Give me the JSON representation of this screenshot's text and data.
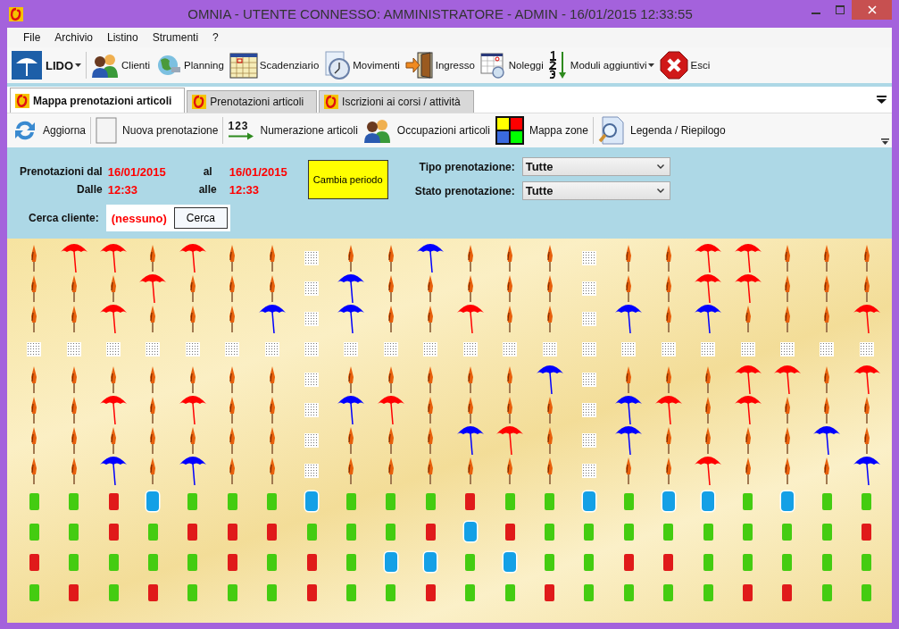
{
  "window": {
    "title": "OMNIA - UTENTE CONNESSO: AMMINISTRATORE - ADMIN - 16/01/2015 12:33:55"
  },
  "menu": [
    "File",
    "Archivio",
    "Listino",
    "Strumenti",
    "?"
  ],
  "toolbar": [
    {
      "label": "LIDO",
      "dropdown": true
    },
    {
      "label": "Clienti",
      "dropdown": false
    },
    {
      "label": "Planning",
      "dropdown": false
    },
    {
      "label": "Scadenziario",
      "dropdown": false
    },
    {
      "label": "Movimenti",
      "dropdown": false
    },
    {
      "label": "Ingresso",
      "dropdown": false
    },
    {
      "label": "Noleggi",
      "dropdown": false
    },
    {
      "label": "Moduli aggiuntivi",
      "dropdown": true
    },
    {
      "label": "Esci",
      "dropdown": false
    }
  ],
  "tabs": [
    {
      "label": "Mappa prenotazioni articoli",
      "selected": true
    },
    {
      "label": "Prenotazioni articoli",
      "selected": false
    },
    {
      "label": "Iscrizioni ai corsi / attività",
      "selected": false
    }
  ],
  "subtoolbar": [
    {
      "label": "Aggiorna"
    },
    {
      "label": "Nuova prenotazione"
    },
    {
      "label": "Numerazione articoli",
      "icon_text": "123"
    },
    {
      "label": "Occupazioni articoli"
    },
    {
      "label": "Mappa zone"
    },
    {
      "label": "Legenda / Riepilogo"
    }
  ],
  "filters": {
    "period_label": "Prenotazioni dal",
    "date_from": "16/01/2015",
    "to_label": "al",
    "date_to": "16/01/2015",
    "time_label": "Dalle",
    "time_from": "12:33",
    "time_to_label": "alle",
    "time_to": "12:33",
    "change_button": "Cambia periodo",
    "customer_label": "Cerca cliente:",
    "customer_value": "(nessuno)",
    "search_button": "Cerca",
    "type_label": "Tipo prenotazione:",
    "type_value": "Tutte",
    "status_label": "Stato prenotazione:",
    "status_value": "Tutte"
  },
  "beach": {
    "rows": [
      {
        "cells": [
          {
            "kind": "closed"
          },
          {
            "kind": "red"
          },
          {
            "kind": "red"
          },
          {
            "kind": "closed"
          },
          {
            "kind": "red"
          },
          {
            "kind": "closed"
          },
          {
            "kind": "closed"
          },
          {
            "kind": "walkway"
          },
          {
            "kind": "closed"
          },
          {
            "kind": "closed"
          },
          {
            "kind": "blue"
          },
          {
            "kind": "closed"
          },
          {
            "kind": "closed"
          },
          {
            "kind": "closed"
          },
          {
            "kind": "walkway"
          },
          {
            "kind": "closed"
          },
          {
            "kind": "closed"
          },
          {
            "kind": "red"
          },
          {
            "kind": "red"
          },
          {
            "kind": "closed"
          },
          {
            "kind": "closed"
          },
          {
            "kind": "closed"
          }
        ]
      },
      {
        "cells": [
          {
            "kind": "closed"
          },
          {
            "kind": "closed"
          },
          {
            "kind": "closed"
          },
          {
            "kind": "red"
          },
          {
            "kind": "closed"
          },
          {
            "kind": "closed"
          },
          {
            "kind": "closed"
          },
          {
            "kind": "walkway"
          },
          {
            "kind": "blue"
          },
          {
            "kind": "closed"
          },
          {
            "kind": "closed"
          },
          {
            "kind": "closed"
          },
          {
            "kind": "closed"
          },
          {
            "kind": "closed"
          },
          {
            "kind": "walkway"
          },
          {
            "kind": "closed"
          },
          {
            "kind": "closed"
          },
          {
            "kind": "red"
          },
          {
            "kind": "red"
          },
          {
            "kind": "closed"
          },
          {
            "kind": "closed"
          },
          {
            "kind": "closed"
          }
        ]
      },
      {
        "cells": [
          {
            "kind": "closed"
          },
          {
            "kind": "closed"
          },
          {
            "kind": "red"
          },
          {
            "kind": "closed"
          },
          {
            "kind": "closed"
          },
          {
            "kind": "closed"
          },
          {
            "kind": "blue"
          },
          {
            "kind": "walkway"
          },
          {
            "kind": "blue"
          },
          {
            "kind": "closed"
          },
          {
            "kind": "closed"
          },
          {
            "kind": "red"
          },
          {
            "kind": "closed"
          },
          {
            "kind": "closed"
          },
          {
            "kind": "walkway"
          },
          {
            "kind": "blue"
          },
          {
            "kind": "closed"
          },
          {
            "kind": "blue"
          },
          {
            "kind": "closed"
          },
          {
            "kind": "closed"
          },
          {
            "kind": "closed"
          },
          {
            "kind": "red"
          }
        ]
      },
      {
        "cells": [
          {
            "kind": "walkway"
          },
          {
            "kind": "walkway"
          },
          {
            "kind": "walkway"
          },
          {
            "kind": "walkway"
          },
          {
            "kind": "walkway"
          },
          {
            "kind": "walkway"
          },
          {
            "kind": "walkway"
          },
          {
            "kind": "walkway"
          },
          {
            "kind": "walkway"
          },
          {
            "kind": "walkway"
          },
          {
            "kind": "walkway"
          },
          {
            "kind": "walkway"
          },
          {
            "kind": "walkway"
          },
          {
            "kind": "walkway"
          },
          {
            "kind": "walkway"
          },
          {
            "kind": "walkway"
          },
          {
            "kind": "walkway"
          },
          {
            "kind": "walkway"
          },
          {
            "kind": "walkway"
          },
          {
            "kind": "walkway"
          },
          {
            "kind": "walkway"
          },
          {
            "kind": "walkway"
          }
        ]
      },
      {
        "cells": [
          {
            "kind": "closed"
          },
          {
            "kind": "closed"
          },
          {
            "kind": "closed"
          },
          {
            "kind": "closed"
          },
          {
            "kind": "closed"
          },
          {
            "kind": "closed"
          },
          {
            "kind": "closed"
          },
          {
            "kind": "walkway"
          },
          {
            "kind": "closed"
          },
          {
            "kind": "closed"
          },
          {
            "kind": "closed"
          },
          {
            "kind": "closed"
          },
          {
            "kind": "closed"
          },
          {
            "kind": "blue"
          },
          {
            "kind": "walkway"
          },
          {
            "kind": "closed"
          },
          {
            "kind": "closed"
          },
          {
            "kind": "closed"
          },
          {
            "kind": "red"
          },
          {
            "kind": "red"
          },
          {
            "kind": "closed"
          },
          {
            "kind": "red"
          }
        ]
      },
      {
        "cells": [
          {
            "kind": "closed"
          },
          {
            "kind": "closed"
          },
          {
            "kind": "red"
          },
          {
            "kind": "closed"
          },
          {
            "kind": "red"
          },
          {
            "kind": "closed"
          },
          {
            "kind": "closed"
          },
          {
            "kind": "walkway"
          },
          {
            "kind": "blue"
          },
          {
            "kind": "red"
          },
          {
            "kind": "closed"
          },
          {
            "kind": "closed"
          },
          {
            "kind": "closed"
          },
          {
            "kind": "closed"
          },
          {
            "kind": "walkway"
          },
          {
            "kind": "blue"
          },
          {
            "kind": "red"
          },
          {
            "kind": "closed"
          },
          {
            "kind": "red"
          },
          {
            "kind": "closed"
          },
          {
            "kind": "closed"
          },
          {
            "kind": "closed"
          }
        ]
      },
      {
        "cells": [
          {
            "kind": "closed"
          },
          {
            "kind": "closed"
          },
          {
            "kind": "closed"
          },
          {
            "kind": "closed"
          },
          {
            "kind": "closed"
          },
          {
            "kind": "closed"
          },
          {
            "kind": "closed"
          },
          {
            "kind": "walkway"
          },
          {
            "kind": "closed"
          },
          {
            "kind": "closed"
          },
          {
            "kind": "closed"
          },
          {
            "kind": "blue"
          },
          {
            "kind": "red"
          },
          {
            "kind": "closed"
          },
          {
            "kind": "walkway"
          },
          {
            "kind": "blue"
          },
          {
            "kind": "closed"
          },
          {
            "kind": "closed"
          },
          {
            "kind": "closed"
          },
          {
            "kind": "closed"
          },
          {
            "kind": "blue"
          },
          {
            "kind": "closed"
          }
        ]
      },
      {
        "cells": [
          {
            "kind": "closed"
          },
          {
            "kind": "closed"
          },
          {
            "kind": "blue"
          },
          {
            "kind": "closed"
          },
          {
            "kind": "blue"
          },
          {
            "kind": "closed"
          },
          {
            "kind": "closed"
          },
          {
            "kind": "walkway"
          },
          {
            "kind": "closed"
          },
          {
            "kind": "closed"
          },
          {
            "kind": "closed"
          },
          {
            "kind": "closed"
          },
          {
            "kind": "closed"
          },
          {
            "kind": "closed"
          },
          {
            "kind": "walkway"
          },
          {
            "kind": "closed"
          },
          {
            "kind": "closed"
          },
          {
            "kind": "red"
          },
          {
            "kind": "closed"
          },
          {
            "kind": "closed"
          },
          {
            "kind": "closed"
          },
          {
            "kind": "blue"
          }
        ]
      },
      {
        "cells": [
          {
            "kind": "cabin-green"
          },
          {
            "kind": "cabin-green"
          },
          {
            "kind": "cabin-red"
          },
          {
            "kind": "cabin-blue"
          },
          {
            "kind": "cabin-green"
          },
          {
            "kind": "cabin-green"
          },
          {
            "kind": "cabin-green"
          },
          {
            "kind": "cabin-blue"
          },
          {
            "kind": "cabin-green"
          },
          {
            "kind": "cabin-green"
          },
          {
            "kind": "cabin-green"
          },
          {
            "kind": "cabin-red"
          },
          {
            "kind": "cabin-green"
          },
          {
            "kind": "cabin-green"
          },
          {
            "kind": "cabin-blue"
          },
          {
            "kind": "cabin-green"
          },
          {
            "kind": "cabin-blue"
          },
          {
            "kind": "cabin-blue"
          },
          {
            "kind": "cabin-green"
          },
          {
            "kind": "cabin-blue"
          },
          {
            "kind": "cabin-green"
          },
          {
            "kind": "cabin-green"
          }
        ]
      },
      {
        "cells": [
          {
            "kind": "cabin-green"
          },
          {
            "kind": "cabin-green"
          },
          {
            "kind": "cabin-red"
          },
          {
            "kind": "cabin-green"
          },
          {
            "kind": "cabin-red"
          },
          {
            "kind": "cabin-red"
          },
          {
            "kind": "cabin-red"
          },
          {
            "kind": "cabin-green"
          },
          {
            "kind": "cabin-green"
          },
          {
            "kind": "cabin-green"
          },
          {
            "kind": "cabin-red"
          },
          {
            "kind": "cabin-blue"
          },
          {
            "kind": "cabin-red"
          },
          {
            "kind": "cabin-green"
          },
          {
            "kind": "cabin-green"
          },
          {
            "kind": "cabin-green"
          },
          {
            "kind": "cabin-green"
          },
          {
            "kind": "cabin-green"
          },
          {
            "kind": "cabin-green"
          },
          {
            "kind": "cabin-green"
          },
          {
            "kind": "cabin-green"
          },
          {
            "kind": "cabin-red"
          }
        ]
      },
      {
        "cells": [
          {
            "kind": "cabin-red"
          },
          {
            "kind": "cabin-green"
          },
          {
            "kind": "cabin-green"
          },
          {
            "kind": "cabin-green"
          },
          {
            "kind": "cabin-green"
          },
          {
            "kind": "cabin-red"
          },
          {
            "kind": "cabin-green"
          },
          {
            "kind": "cabin-red"
          },
          {
            "kind": "cabin-green"
          },
          {
            "kind": "cabin-blue"
          },
          {
            "kind": "cabin-blue"
          },
          {
            "kind": "cabin-green"
          },
          {
            "kind": "cabin-blue"
          },
          {
            "kind": "cabin-green"
          },
          {
            "kind": "cabin-green"
          },
          {
            "kind": "cabin-red"
          },
          {
            "kind": "cabin-red"
          },
          {
            "kind": "cabin-green"
          },
          {
            "kind": "cabin-green"
          },
          {
            "kind": "cabin-green"
          },
          {
            "kind": "cabin-green"
          },
          {
            "kind": "cabin-green"
          }
        ]
      },
      {
        "cells": [
          {
            "kind": "cabin-green"
          },
          {
            "kind": "cabin-red"
          },
          {
            "kind": "cabin-green"
          },
          {
            "kind": "cabin-red"
          },
          {
            "kind": "cabin-green"
          },
          {
            "kind": "cabin-green"
          },
          {
            "kind": "cabin-green"
          },
          {
            "kind": "cabin-red"
          },
          {
            "kind": "cabin-green"
          },
          {
            "kind": "cabin-green"
          },
          {
            "kind": "cabin-red"
          },
          {
            "kind": "cabin-green"
          },
          {
            "kind": "cabin-green"
          },
          {
            "kind": "cabin-red"
          },
          {
            "kind": "cabin-green"
          },
          {
            "kind": "cabin-green"
          },
          {
            "kind": "cabin-green"
          },
          {
            "kind": "cabin-green"
          },
          {
            "kind": "cabin-red"
          },
          {
            "kind": "cabin-red"
          },
          {
            "kind": "cabin-green"
          },
          {
            "kind": "cabin-green"
          }
        ]
      }
    ]
  }
}
